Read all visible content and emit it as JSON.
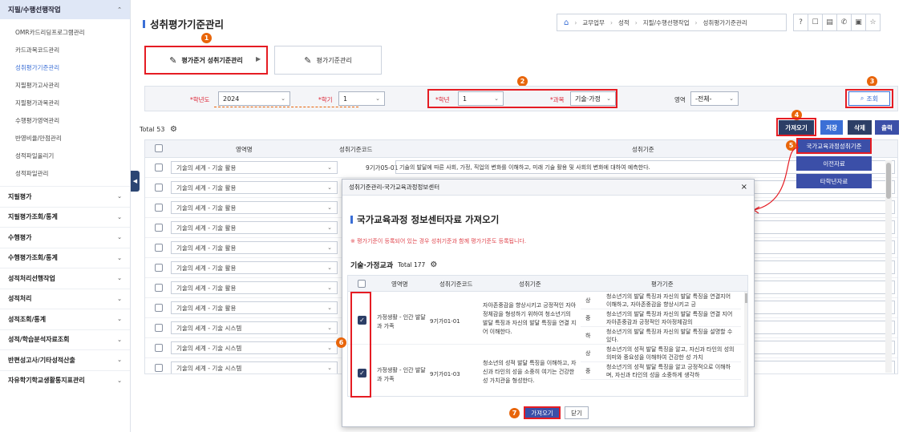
{
  "sidebar": {
    "header": "지필/수행선행작업",
    "subitems": [
      "OMR카드리딩프로그램관리",
      "카드과목코드관리",
      "성취평가기준관리",
      "지필평가고사관리",
      "지필평가과목관리",
      "수행평가영역관리",
      "반영비율/만점관리",
      "성적파일올리기",
      "성적파일관리"
    ],
    "groups": [
      "지필평가",
      "지필평가조회/통계",
      "수행평가",
      "수행평가조회/통계",
      "성적처리선행작업",
      "성적처리",
      "성적조회/통계",
      "성적/학습분석자료조회",
      "반편성고사/기타성적산출",
      "자유학기학교생활통지표관리"
    ]
  },
  "page": {
    "title": "성취평가기준관리",
    "breadcrumb": [
      "교무업무",
      "성적",
      "지필/수행선행작업",
      "성취평가기준관리"
    ],
    "step1": "평가준거 성취기준관리",
    "step2": "평가기준관리"
  },
  "badges": [
    "1",
    "2",
    "3",
    "4",
    "5",
    "6",
    "7"
  ],
  "filter": {
    "year_label": "*학년도",
    "year_value": "2024",
    "term_label": "*학기",
    "term_value": "1",
    "grade_label": "*학년",
    "grade_value": "1",
    "subject_label": "*과목",
    "subject_value": "기술·가정",
    "area_label": "영역",
    "area_value": "-전체-",
    "search_label": "조회"
  },
  "toolbar": {
    "total": "Total 53",
    "import": "가져오기",
    "save": "저장",
    "delete": "삭제",
    "print": "출력",
    "menu": [
      "국가교육과정성취기준",
      "이전자료",
      "타학년자료"
    ]
  },
  "grid": {
    "headers": [
      "영역명",
      "성취기준코드",
      "성취기준"
    ],
    "rows": [
      {
        "area": "기술의 세계 - 기술 활용",
        "code": "9기가05-01",
        "text": "기술의 발달에 따른 사회, 가정, 직업의 변화를 이해하고, 미래 기술 활용 및 사회의 변화에 대하여 예측한다."
      },
      {
        "area": "기술의 세계 - 기술 활용",
        "code": "",
        "text": ""
      },
      {
        "area": "기술의 세계 - 기술 활용",
        "code": "",
        "text": ""
      },
      {
        "area": "기술의 세계 - 기술 활용",
        "code": "",
        "text": ""
      },
      {
        "area": "기술의 세계 - 기술 활용",
        "code": "",
        "text": ""
      },
      {
        "area": "기술의 세계 - 기술 활용",
        "code": "",
        "text": ""
      },
      {
        "area": "기술의 세계 - 기술 활용",
        "code": "",
        "text": ""
      },
      {
        "area": "기술의 세계 - 기술 활용",
        "code": "",
        "text": ""
      },
      {
        "area": "기술의 세계 - 기술 시스템",
        "code": "",
        "text": ""
      },
      {
        "area": "기술의 세계 - 기술 시스템",
        "code": "",
        "text": ""
      },
      {
        "area": "기술의 세계 - 기술 시스템",
        "code": "",
        "text": ""
      }
    ]
  },
  "modal": {
    "header": "성취기준관리-국가교육과정정보센터",
    "title": "국가교육과정 정보센터자료 가져오기",
    "note": "※ 평가기준이 등록되어 있는 경우 성취기준과 함께 평가기준도 등록됩니다.",
    "subtitle": "기술·가정교과",
    "total": "Total 177",
    "headers": [
      "영역명",
      "성취기준코드",
      "성취기준",
      "평가기준"
    ],
    "rows": [
      {
        "area": "가정생활 - 인간 발달과 가족",
        "code": "9기가01-01",
        "standard": "자아존중감을 향상시키고 긍정적인 자아정체감을 형성하기 위하여 청소년기의 발달 특징과 자신의 발달 특징을 연결 지어 이해한다.",
        "levels": [
          {
            "level": "상",
            "text": "청소년기의 발달 특징과 자신의 발달 특징을 연결지어 이해하고, 자아존중감을 향상시키고 긍"
          },
          {
            "level": "중",
            "text": "청소년기의 발달 특징과 자신의 발달 특징을 연결 지어 자아존중감과 긍정적인 자아정체감의"
          },
          {
            "level": "하",
            "text": "청소년기의 발달 특징과 자신의 발달 특징을 설명할 수 있다."
          }
        ]
      },
      {
        "area": "가정생활 - 인간 발달과 가족",
        "code": "9기가01-03",
        "standard": "청소년의 성적 발달 특징을 이해하고, 자신과 타인의 성을 소중히 여기는 건강한 성 가치관을 형성한다.",
        "levels": [
          {
            "level": "상",
            "text": "청소년기의 성적 발달 특징을 알고, 자신과 타인의 성의 의미와 중요성을 이해하여 건강한 성 가치"
          },
          {
            "level": "중",
            "text": "청소년기의 성적 발달 특징을 알고 긍정적으로 이해하며, 자신과 타인의 성을 소중하게 생각하"
          }
        ]
      }
    ],
    "ok": "가져오기",
    "close": "닫기"
  }
}
